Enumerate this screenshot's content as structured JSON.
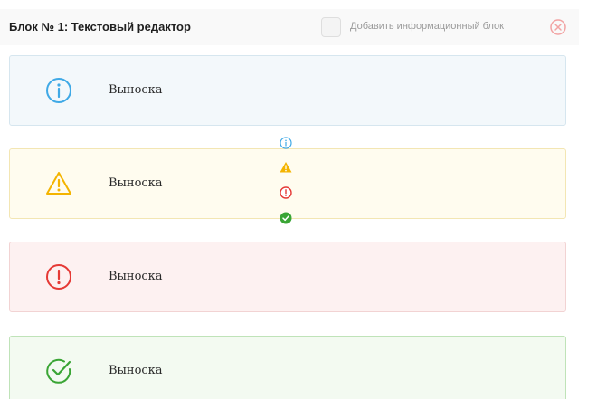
{
  "header": {
    "title": "Блок № 1: Текстовый редактор",
    "add_block_label": "Добавить информационный блок",
    "close_icon": "close-circle-icon"
  },
  "blocks": [
    {
      "type": "info",
      "text": "Выноска",
      "icon": "info-circle-icon",
      "color": "#3fa9e6"
    },
    {
      "type": "warning",
      "text": "Выноска",
      "icon": "warning-triangle-icon",
      "color": "#f4b400"
    },
    {
      "type": "error",
      "text": "Выноска",
      "icon": "exclamation-circle-icon",
      "color": "#e53935"
    },
    {
      "type": "success",
      "text": "Выноска",
      "icon": "check-circle-icon",
      "color": "#3aa535"
    }
  ],
  "type_picker": {
    "options": [
      "info-icon",
      "warning-icon",
      "error-icon",
      "success-icon"
    ]
  }
}
